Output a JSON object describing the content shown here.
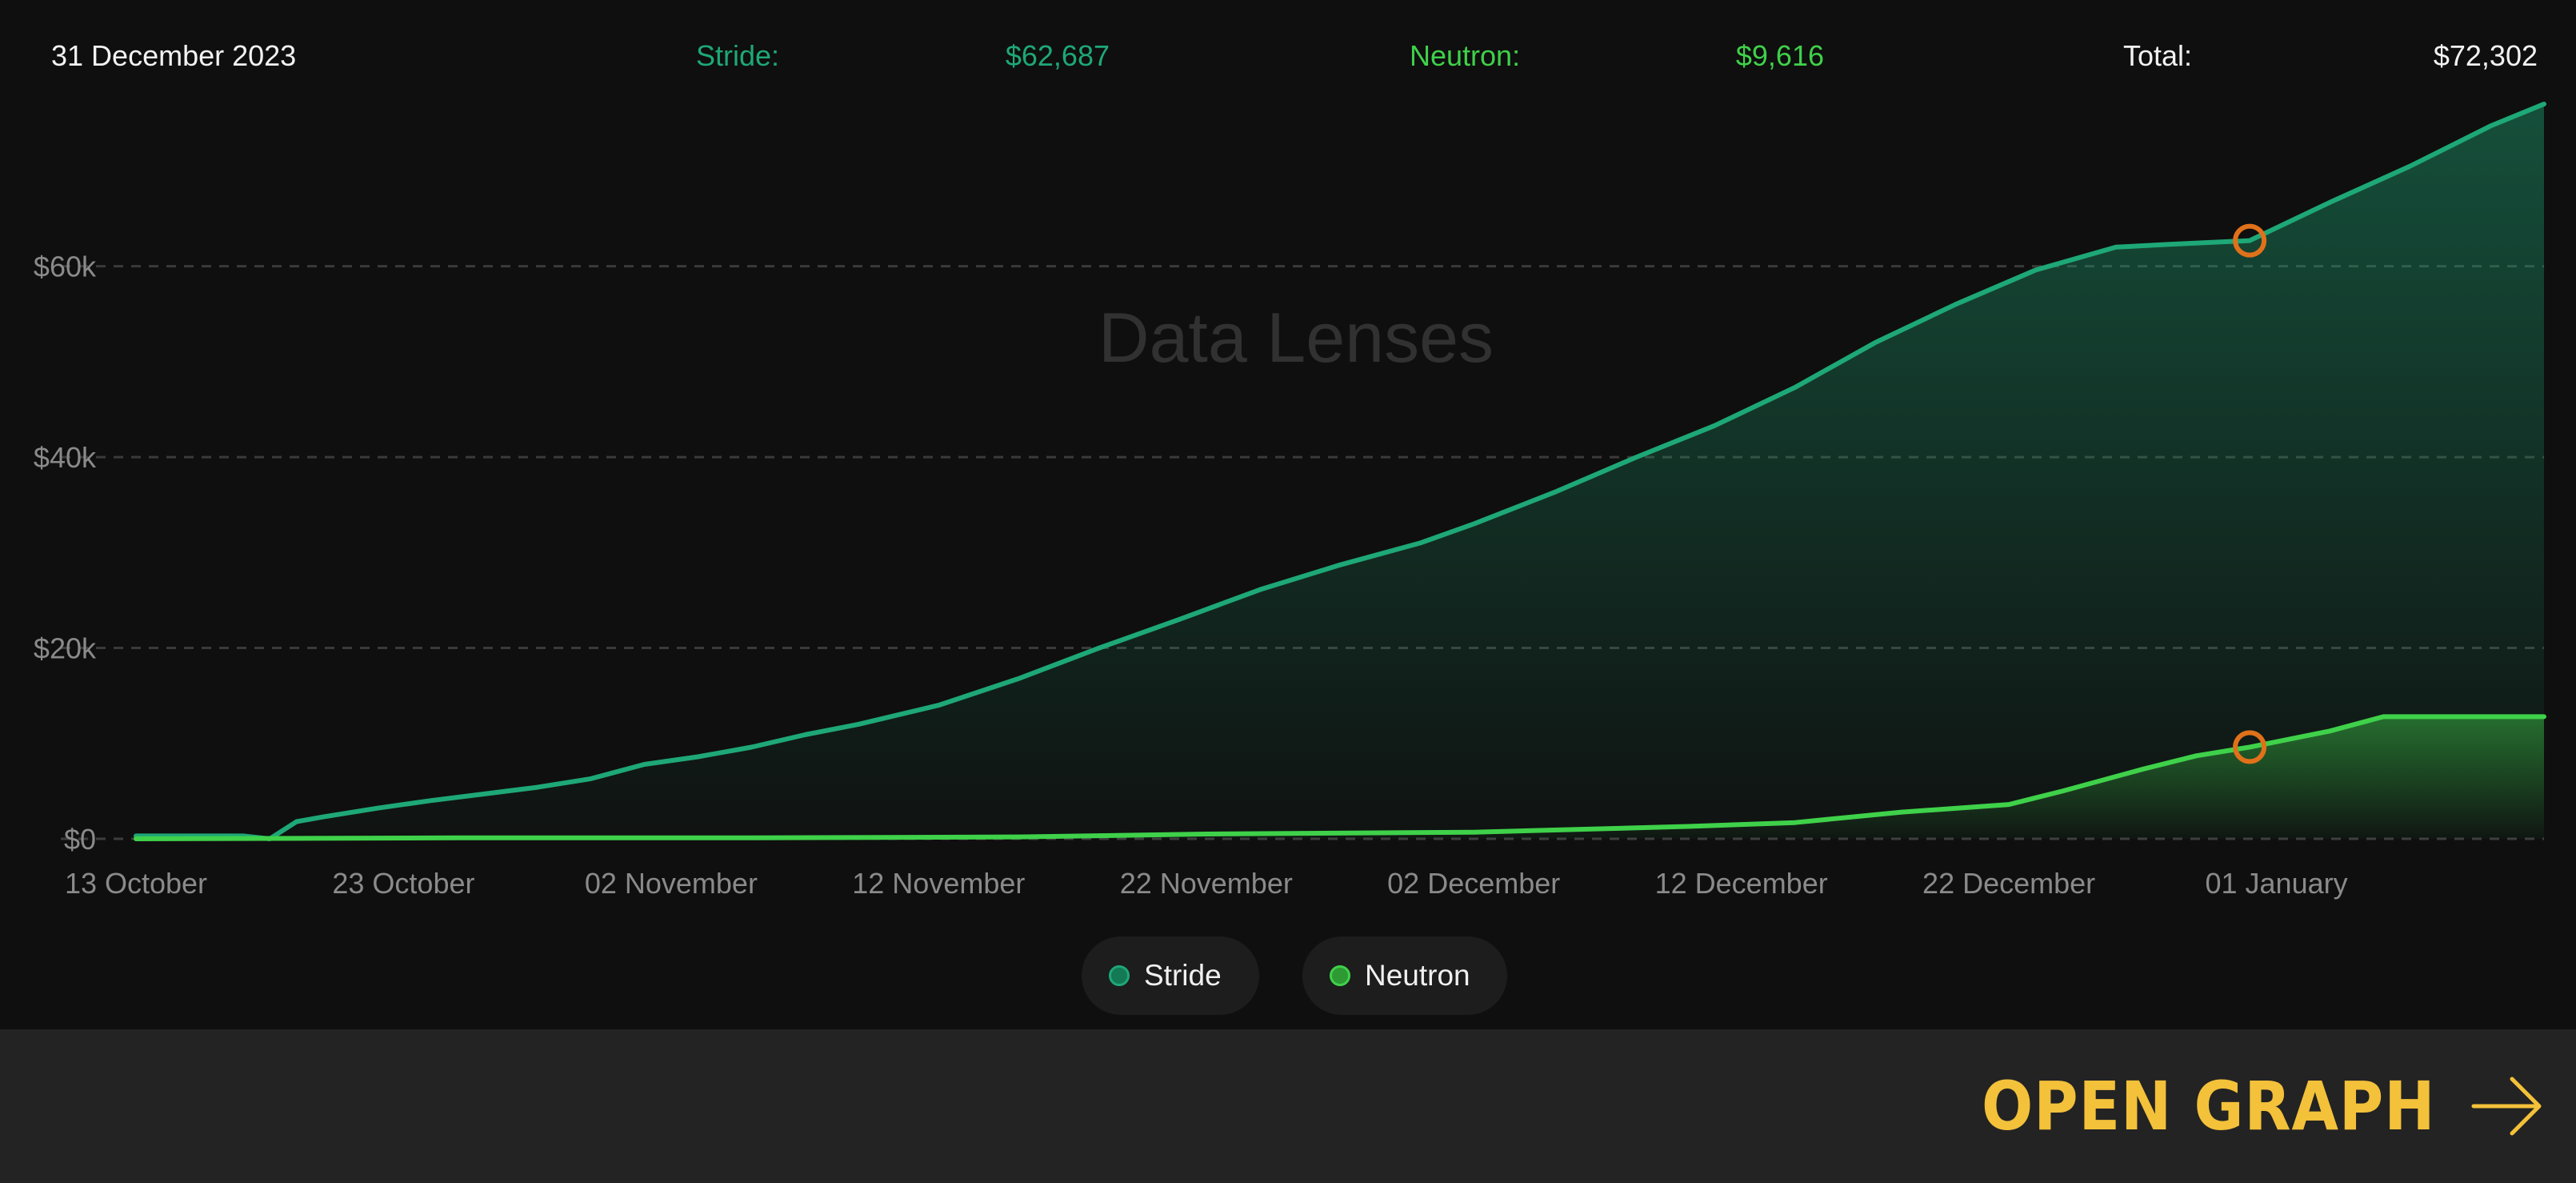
{
  "header": {
    "date": "31 December 2023",
    "stride_label": "Stride:",
    "stride_value": "$62,687",
    "neutron_label": "Neutron:",
    "neutron_value": "$9,616",
    "total_label": "Total:",
    "total_value": "$72,302"
  },
  "watermark": "Data Lenses",
  "legend": {
    "stride": "Stride",
    "neutron": "Neutron"
  },
  "footer": {
    "open_graph_label": "OPEN GRAPH"
  },
  "colors": {
    "stride": "#1ea877",
    "neutron": "#3fd14a",
    "marker": "#e0711a",
    "accent": "#f3c13a"
  },
  "chart_data": {
    "type": "area",
    "ylim": [
      0,
      77000
    ],
    "xlim": [
      "2023-10-13",
      "2024-01-11"
    ],
    "yticks": [
      {
        "value": 0,
        "label": "$0"
      },
      {
        "value": 20000,
        "label": "$20k"
      },
      {
        "value": 40000,
        "label": "$40k"
      },
      {
        "value": 60000,
        "label": "$60k"
      }
    ],
    "xticks": [
      {
        "date": "2023-10-13",
        "label": "13 October"
      },
      {
        "date": "2023-10-23",
        "label": "23 October"
      },
      {
        "date": "2023-11-02",
        "label": "02 November"
      },
      {
        "date": "2023-11-12",
        "label": "12 November"
      },
      {
        "date": "2023-11-22",
        "label": "22 November"
      },
      {
        "date": "2023-12-02",
        "label": "02 December"
      },
      {
        "date": "2023-12-12",
        "label": "12 December"
      },
      {
        "date": "2023-12-22",
        "label": "22 December"
      },
      {
        "date": "2024-01-01",
        "label": "01 January"
      }
    ],
    "highlight_date": "2023-12-31",
    "highlight_values": {
      "Stride": 62687,
      "Neutron": 9616
    },
    "grid": true,
    "legend_position": "bottom-center",
    "series": [
      {
        "name": "Stride",
        "x": [
          "2023-10-13",
          "2023-10-15",
          "2023-10-17",
          "2023-10-18",
          "2023-10-19",
          "2023-10-20",
          "2023-10-22",
          "2023-10-24",
          "2023-10-26",
          "2023-10-28",
          "2023-10-30",
          "2023-11-01",
          "2023-11-03",
          "2023-11-05",
          "2023-11-07",
          "2023-11-09",
          "2023-11-12",
          "2023-11-15",
          "2023-11-18",
          "2023-11-21",
          "2023-11-24",
          "2023-11-27",
          "2023-11-30",
          "2023-12-02",
          "2023-12-05",
          "2023-12-08",
          "2023-12-11",
          "2023-12-14",
          "2023-12-17",
          "2023-12-20",
          "2023-12-23",
          "2023-12-26",
          "2023-12-28",
          "2023-12-31",
          "2024-01-03",
          "2024-01-06",
          "2024-01-09",
          "2024-01-11"
        ],
        "values": [
          300,
          300,
          300,
          0,
          1800,
          2300,
          3200,
          4000,
          4700,
          5400,
          6300,
          7800,
          8600,
          9600,
          10900,
          12000,
          14000,
          16800,
          20000,
          23000,
          26100,
          28700,
          31000,
          33000,
          36300,
          39900,
          43300,
          47300,
          52000,
          56000,
          59600,
          62000,
          62300,
          62687,
          66700,
          70500,
          74700,
          77000
        ]
      },
      {
        "name": "Neutron",
        "x": [
          "2023-10-13",
          "2023-10-25",
          "2023-11-05",
          "2023-11-15",
          "2023-11-22",
          "2023-12-02",
          "2023-12-10",
          "2023-12-14",
          "2023-12-18",
          "2023-12-21",
          "2023-12-22",
          "2023-12-24",
          "2023-12-27",
          "2023-12-29",
          "2023-12-31",
          "2024-01-03",
          "2024-01-05",
          "2024-01-11"
        ],
        "values": [
          0,
          100,
          100,
          200,
          500,
          700,
          1300,
          1700,
          2800,
          3400,
          3600,
          5000,
          7300,
          8700,
          9616,
          11300,
          12800,
          12800
        ]
      }
    ]
  }
}
